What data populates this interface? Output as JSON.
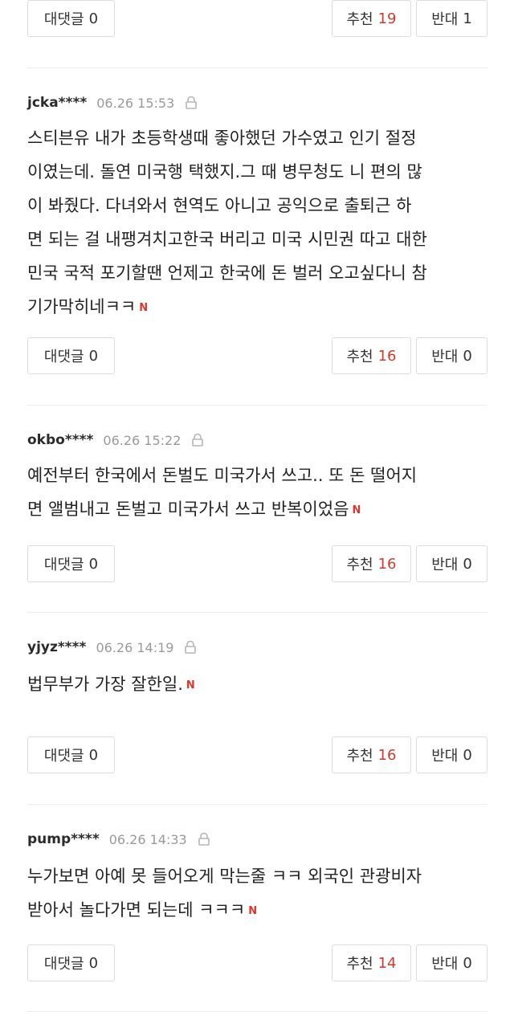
{
  "labels": {
    "reply": "대댓글",
    "recommend": "추천",
    "oppose": "반대",
    "new_badge": "N"
  },
  "top_bar": {
    "reply_count": "0",
    "recommend_count": "19",
    "oppose_count": "1"
  },
  "comments": [
    {
      "user": "jcka****",
      "date": "06.26 15:53",
      "text": "스티븐유 내가 초등학생때 좋아했던 가수였고 인기 절정\n이였는데. 돌연 미국행 택했지.그 때 병무청도 니 편의 많\n이 봐줬다. 다녀와서 현역도 아니고 공익으로 출퇴근 하\n면 되는 걸 내팽겨치고한국 버리고 미국 시민권 따고 대한\n민국 국적 포기할땐 언제고 한국에 돈 벌러 오고싶다니 참\n기가막히네ㅋㅋ",
      "reply_count": "0",
      "recommend_count": "16",
      "oppose_count": "0"
    },
    {
      "user": "okbo****",
      "date": "06.26 15:22",
      "text": "예전부터 한국에서 돈벌도 미국가서 쓰고.. 또 돈 떨어지\n면 앨범내고 돈벌고 미국가서 쓰고 반복이었음",
      "reply_count": "0",
      "recommend_count": "16",
      "oppose_count": "0"
    },
    {
      "user": "yjyz****",
      "date": "06.26 14:19",
      "text": "법무부가 가장 잘한일.",
      "reply_count": "0",
      "recommend_count": "16",
      "oppose_count": "0"
    },
    {
      "user": "pump****",
      "date": "06.26 14:33",
      "text": "누가보면 아예 못 들어오게 막는줄 ㅋㅋ 외국인 관광비자\n받아서 놀다가면 되는데 ㅋㅋㅋ",
      "reply_count": "0",
      "recommend_count": "14",
      "oppose_count": "0"
    }
  ],
  "colors": {
    "accent_red": "#d03a2e",
    "new_badge": "#e0342a"
  },
  "icons": {
    "lock": "lock-icon"
  }
}
